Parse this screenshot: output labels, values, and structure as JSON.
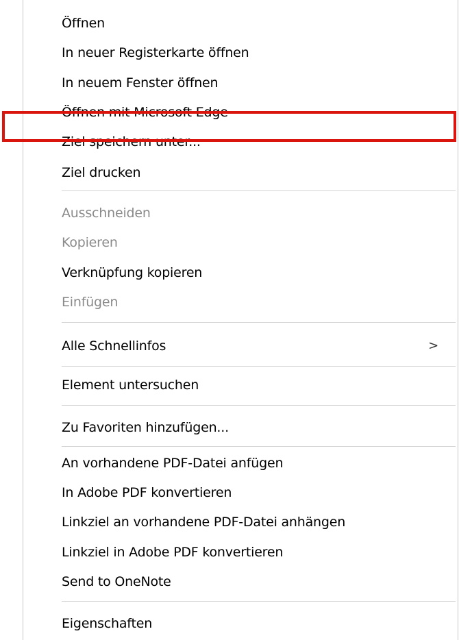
{
  "context_menu": {
    "items": [
      {
        "label": "Öffnen",
        "enabled": true
      },
      {
        "label": "In neuer Registerkarte öffnen",
        "enabled": true
      },
      {
        "label": "In neuem Fenster öffnen",
        "enabled": true
      },
      {
        "label": "Öffnen mit Microsoft Edge",
        "enabled": true
      },
      {
        "label": "Ziel speichern unter...",
        "enabled": true,
        "highlighted": true
      },
      {
        "label": "Ziel drucken",
        "enabled": true
      },
      {
        "label": "Ausschneiden",
        "enabled": false
      },
      {
        "label": "Kopieren",
        "enabled": false
      },
      {
        "label": "Verknüpfung kopieren",
        "enabled": true
      },
      {
        "label": "Einfügen",
        "enabled": false
      },
      {
        "label": "Alle Schnellinfos",
        "enabled": true,
        "submenu": true,
        "submenu_glyph": ">"
      },
      {
        "label": "Element untersuchen",
        "enabled": true
      },
      {
        "label": "Zu Favoriten hinzufügen...",
        "enabled": true
      },
      {
        "label": "An vorhandene PDF-Datei anfügen",
        "enabled": true
      },
      {
        "label": "In Adobe PDF konvertieren",
        "enabled": true
      },
      {
        "label": "Linkziel an vorhandene PDF-Datei anhängen",
        "enabled": true
      },
      {
        "label": "Linkziel in Adobe PDF konvertieren",
        "enabled": true
      },
      {
        "label": "Send to OneNote",
        "enabled": true
      },
      {
        "label": "Eigenschaften",
        "enabled": true
      }
    ]
  },
  "colors": {
    "highlight_border": "#d9150d",
    "disabled_text": "#8a8a8a",
    "separator": "#d2d2d2"
  }
}
